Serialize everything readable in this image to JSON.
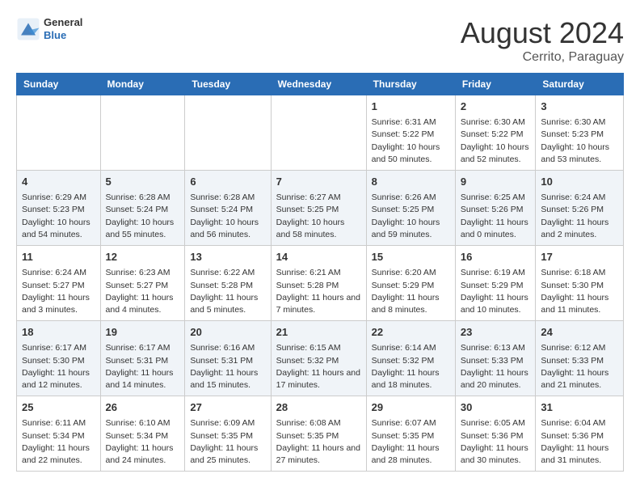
{
  "header": {
    "logo_general": "General",
    "logo_blue": "Blue",
    "title": "August 2024",
    "subtitle": "Cerrito, Paraguay"
  },
  "days_of_week": [
    "Sunday",
    "Monday",
    "Tuesday",
    "Wednesday",
    "Thursday",
    "Friday",
    "Saturday"
  ],
  "weeks": [
    [
      {
        "day": "",
        "sunrise": "",
        "sunset": "",
        "daylight": ""
      },
      {
        "day": "",
        "sunrise": "",
        "sunset": "",
        "daylight": ""
      },
      {
        "day": "",
        "sunrise": "",
        "sunset": "",
        "daylight": ""
      },
      {
        "day": "",
        "sunrise": "",
        "sunset": "",
        "daylight": ""
      },
      {
        "day": "1",
        "sunrise": "Sunrise: 6:31 AM",
        "sunset": "Sunset: 5:22 PM",
        "daylight": "Daylight: 10 hours and 50 minutes."
      },
      {
        "day": "2",
        "sunrise": "Sunrise: 6:30 AM",
        "sunset": "Sunset: 5:22 PM",
        "daylight": "Daylight: 10 hours and 52 minutes."
      },
      {
        "day": "3",
        "sunrise": "Sunrise: 6:30 AM",
        "sunset": "Sunset: 5:23 PM",
        "daylight": "Daylight: 10 hours and 53 minutes."
      }
    ],
    [
      {
        "day": "4",
        "sunrise": "Sunrise: 6:29 AM",
        "sunset": "Sunset: 5:23 PM",
        "daylight": "Daylight: 10 hours and 54 minutes."
      },
      {
        "day": "5",
        "sunrise": "Sunrise: 6:28 AM",
        "sunset": "Sunset: 5:24 PM",
        "daylight": "Daylight: 10 hours and 55 minutes."
      },
      {
        "day": "6",
        "sunrise": "Sunrise: 6:28 AM",
        "sunset": "Sunset: 5:24 PM",
        "daylight": "Daylight: 10 hours and 56 minutes."
      },
      {
        "day": "7",
        "sunrise": "Sunrise: 6:27 AM",
        "sunset": "Sunset: 5:25 PM",
        "daylight": "Daylight: 10 hours and 58 minutes."
      },
      {
        "day": "8",
        "sunrise": "Sunrise: 6:26 AM",
        "sunset": "Sunset: 5:25 PM",
        "daylight": "Daylight: 10 hours and 59 minutes."
      },
      {
        "day": "9",
        "sunrise": "Sunrise: 6:25 AM",
        "sunset": "Sunset: 5:26 PM",
        "daylight": "Daylight: 11 hours and 0 minutes."
      },
      {
        "day": "10",
        "sunrise": "Sunrise: 6:24 AM",
        "sunset": "Sunset: 5:26 PM",
        "daylight": "Daylight: 11 hours and 2 minutes."
      }
    ],
    [
      {
        "day": "11",
        "sunrise": "Sunrise: 6:24 AM",
        "sunset": "Sunset: 5:27 PM",
        "daylight": "Daylight: 11 hours and 3 minutes."
      },
      {
        "day": "12",
        "sunrise": "Sunrise: 6:23 AM",
        "sunset": "Sunset: 5:27 PM",
        "daylight": "Daylight: 11 hours and 4 minutes."
      },
      {
        "day": "13",
        "sunrise": "Sunrise: 6:22 AM",
        "sunset": "Sunset: 5:28 PM",
        "daylight": "Daylight: 11 hours and 5 minutes."
      },
      {
        "day": "14",
        "sunrise": "Sunrise: 6:21 AM",
        "sunset": "Sunset: 5:28 PM",
        "daylight": "Daylight: 11 hours and 7 minutes."
      },
      {
        "day": "15",
        "sunrise": "Sunrise: 6:20 AM",
        "sunset": "Sunset: 5:29 PM",
        "daylight": "Daylight: 11 hours and 8 minutes."
      },
      {
        "day": "16",
        "sunrise": "Sunrise: 6:19 AM",
        "sunset": "Sunset: 5:29 PM",
        "daylight": "Daylight: 11 hours and 10 minutes."
      },
      {
        "day": "17",
        "sunrise": "Sunrise: 6:18 AM",
        "sunset": "Sunset: 5:30 PM",
        "daylight": "Daylight: 11 hours and 11 minutes."
      }
    ],
    [
      {
        "day": "18",
        "sunrise": "Sunrise: 6:17 AM",
        "sunset": "Sunset: 5:30 PM",
        "daylight": "Daylight: 11 hours and 12 minutes."
      },
      {
        "day": "19",
        "sunrise": "Sunrise: 6:17 AM",
        "sunset": "Sunset: 5:31 PM",
        "daylight": "Daylight: 11 hours and 14 minutes."
      },
      {
        "day": "20",
        "sunrise": "Sunrise: 6:16 AM",
        "sunset": "Sunset: 5:31 PM",
        "daylight": "Daylight: 11 hours and 15 minutes."
      },
      {
        "day": "21",
        "sunrise": "Sunrise: 6:15 AM",
        "sunset": "Sunset: 5:32 PM",
        "daylight": "Daylight: 11 hours and 17 minutes."
      },
      {
        "day": "22",
        "sunrise": "Sunrise: 6:14 AM",
        "sunset": "Sunset: 5:32 PM",
        "daylight": "Daylight: 11 hours and 18 minutes."
      },
      {
        "day": "23",
        "sunrise": "Sunrise: 6:13 AM",
        "sunset": "Sunset: 5:33 PM",
        "daylight": "Daylight: 11 hours and 20 minutes."
      },
      {
        "day": "24",
        "sunrise": "Sunrise: 6:12 AM",
        "sunset": "Sunset: 5:33 PM",
        "daylight": "Daylight: 11 hours and 21 minutes."
      }
    ],
    [
      {
        "day": "25",
        "sunrise": "Sunrise: 6:11 AM",
        "sunset": "Sunset: 5:34 PM",
        "daylight": "Daylight: 11 hours and 22 minutes."
      },
      {
        "day": "26",
        "sunrise": "Sunrise: 6:10 AM",
        "sunset": "Sunset: 5:34 PM",
        "daylight": "Daylight: 11 hours and 24 minutes."
      },
      {
        "day": "27",
        "sunrise": "Sunrise: 6:09 AM",
        "sunset": "Sunset: 5:35 PM",
        "daylight": "Daylight: 11 hours and 25 minutes."
      },
      {
        "day": "28",
        "sunrise": "Sunrise: 6:08 AM",
        "sunset": "Sunset: 5:35 PM",
        "daylight": "Daylight: 11 hours and 27 minutes."
      },
      {
        "day": "29",
        "sunrise": "Sunrise: 6:07 AM",
        "sunset": "Sunset: 5:35 PM",
        "daylight": "Daylight: 11 hours and 28 minutes."
      },
      {
        "day": "30",
        "sunrise": "Sunrise: 6:05 AM",
        "sunset": "Sunset: 5:36 PM",
        "daylight": "Daylight: 11 hours and 30 minutes."
      },
      {
        "day": "31",
        "sunrise": "Sunrise: 6:04 AM",
        "sunset": "Sunset: 5:36 PM",
        "daylight": "Daylight: 11 hours and 31 minutes."
      }
    ]
  ]
}
